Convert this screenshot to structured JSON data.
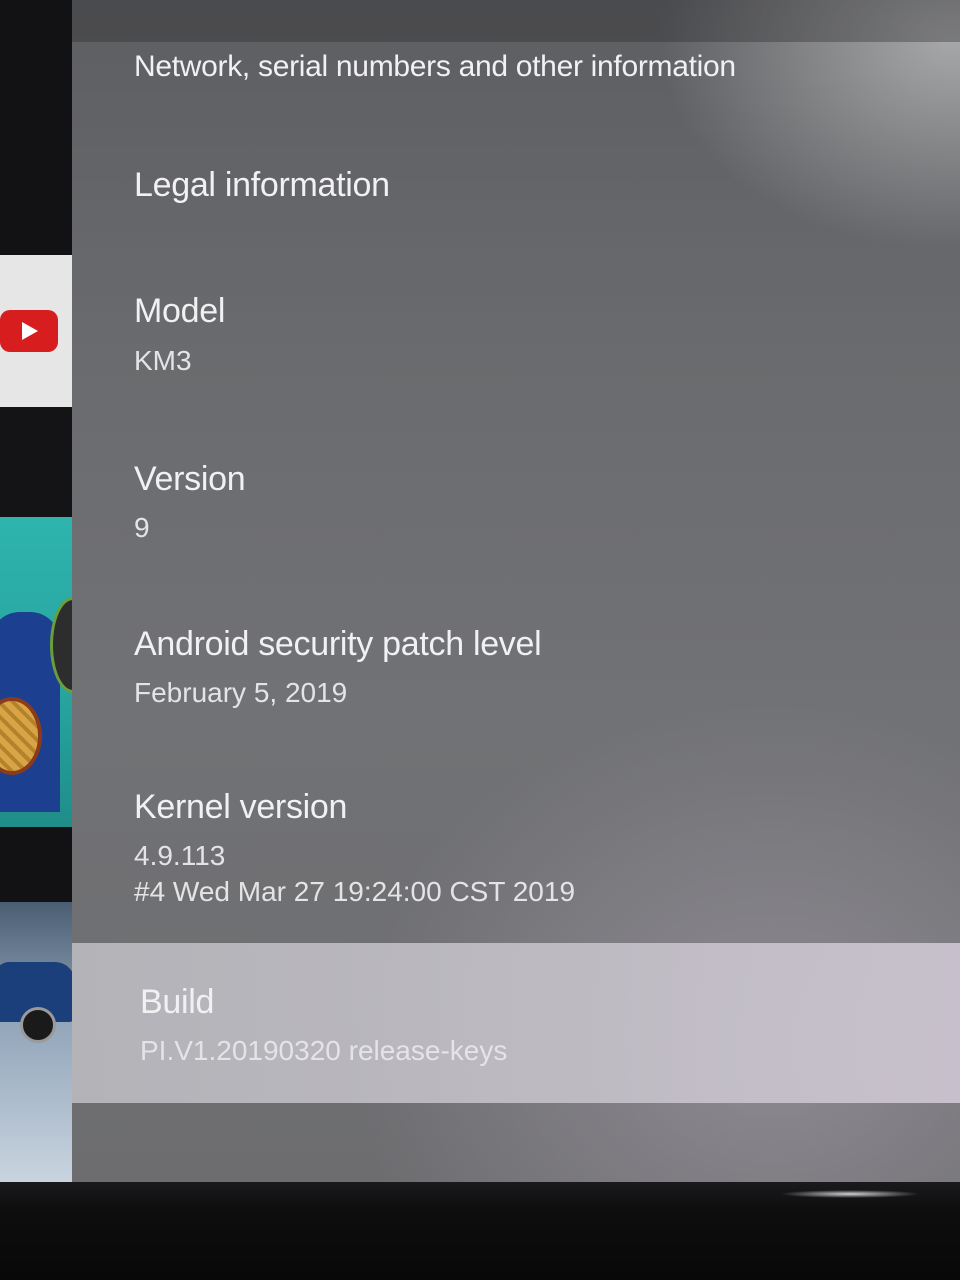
{
  "settings": {
    "network_info": {
      "title": "Network, serial numbers and other information"
    },
    "legal": {
      "title": "Legal information"
    },
    "model": {
      "title": "Model",
      "value": "KM3"
    },
    "version": {
      "title": "Version",
      "value": "9"
    },
    "security_patch": {
      "title": "Android security patch level",
      "value": "February 5, 2019"
    },
    "kernel": {
      "title": "Kernel version",
      "value_line1": "4.9.113",
      "value_line2": "#4 Wed Mar 27 19:24:00 CST 2019"
    },
    "build": {
      "title": "Build",
      "value": "PI.V1.20190320 release-keys"
    }
  },
  "colors": {
    "panel_background": "#6a6b6e",
    "selected_row": "#bfbcc3",
    "text_primary": "#f1f1f3"
  },
  "icons": [
    "youtube-logo-icon"
  ]
}
